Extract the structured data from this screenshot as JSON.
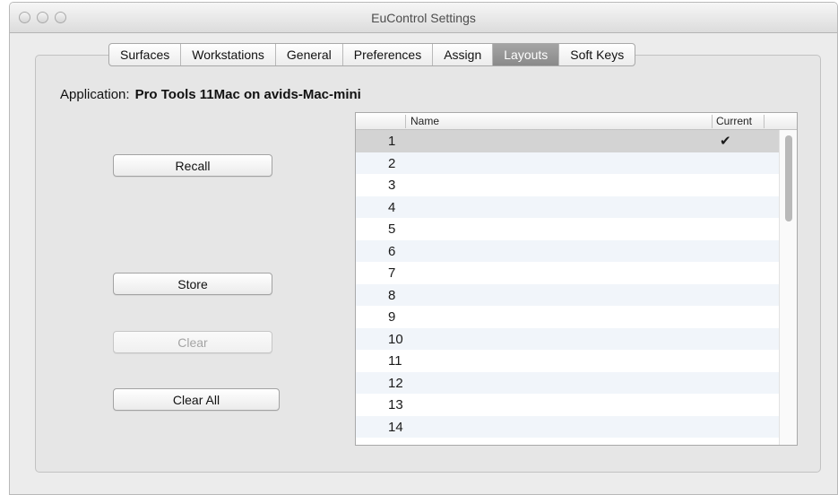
{
  "window": {
    "title": "EuControl Settings"
  },
  "tabs": [
    {
      "label": "Surfaces",
      "active": false
    },
    {
      "label": "Workstations",
      "active": false
    },
    {
      "label": "General",
      "active": false
    },
    {
      "label": "Preferences",
      "active": false
    },
    {
      "label": "Assign",
      "active": false
    },
    {
      "label": "Layouts",
      "active": true
    },
    {
      "label": "Soft Keys",
      "active": false
    }
  ],
  "application": {
    "label": "Application:",
    "value": "Pro Tools 11Mac on avids-Mac-mini"
  },
  "buttons": {
    "recall": "Recall",
    "store": "Store",
    "clear": "Clear",
    "clear_all": "Clear All"
  },
  "table": {
    "columns": {
      "name": "Name",
      "current": "Current"
    },
    "rows": [
      {
        "number": "1",
        "name": "",
        "current": "✔"
      },
      {
        "number": "2",
        "name": "",
        "current": ""
      },
      {
        "number": "3",
        "name": "",
        "current": ""
      },
      {
        "number": "4",
        "name": "",
        "current": ""
      },
      {
        "number": "5",
        "name": "",
        "current": ""
      },
      {
        "number": "6",
        "name": "",
        "current": ""
      },
      {
        "number": "7",
        "name": "",
        "current": ""
      },
      {
        "number": "8",
        "name": "",
        "current": ""
      },
      {
        "number": "9",
        "name": "",
        "current": ""
      },
      {
        "number": "10",
        "name": "",
        "current": ""
      },
      {
        "number": "11",
        "name": "",
        "current": ""
      },
      {
        "number": "12",
        "name": "",
        "current": ""
      },
      {
        "number": "13",
        "name": "",
        "current": ""
      },
      {
        "number": "14",
        "name": "",
        "current": ""
      }
    ],
    "selected_row": 0
  },
  "colors": {
    "active_tab": "#8f8f8f",
    "selected_row": "#d3d3d3",
    "alt_row": "#f1f5fa"
  }
}
